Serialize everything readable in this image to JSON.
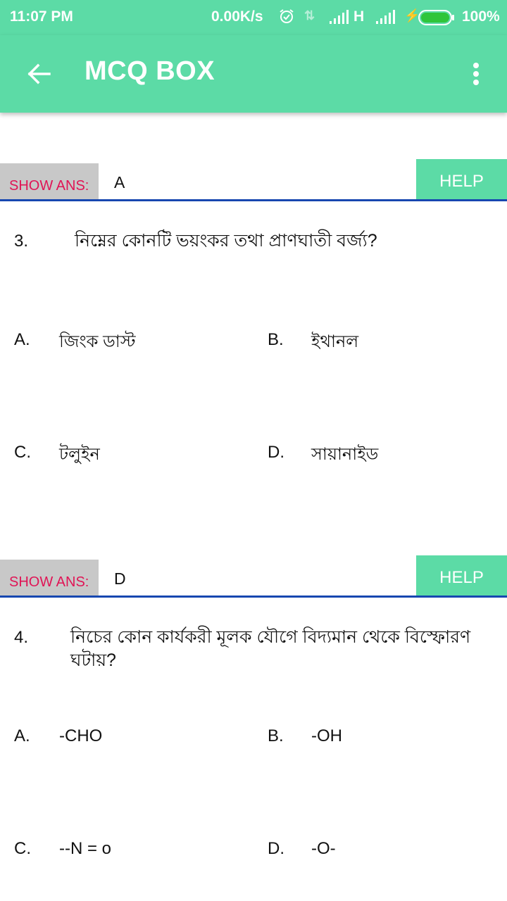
{
  "status_bar": {
    "time": "11:07 PM",
    "net_speed": "0.00K/s",
    "network_type": "H",
    "battery_percent": "100%",
    "icons": [
      "alarm-icon",
      "data-arrows-icon",
      "signal-icon",
      "signal-icon",
      "charging-icon",
      "battery-icon"
    ]
  },
  "app_bar": {
    "title": "MCQ BOX",
    "back_icon": "arrow-left-icon",
    "menu_icon": "more-vert-icon"
  },
  "questions": [
    {
      "show_ans_label": "SHOW ANS:",
      "answer": "A",
      "help_label": "HELP",
      "number": "3.",
      "text": "নিম্নের কোনটি ভয়ংকর তথা প্রাণঘাতী বর্জ্য?",
      "options": [
        {
          "label": "A.",
          "text": "জিংক ডাস্ট"
        },
        {
          "label": "B.",
          "text": "ইথানল"
        },
        {
          "label": "C.",
          "text": "টলুইন"
        },
        {
          "label": "D.",
          "text": "সায়ানাইড"
        }
      ]
    },
    {
      "show_ans_label": "SHOW ANS:",
      "answer": "D",
      "help_label": "HELP",
      "number": "4.",
      "text": "নিচের কোন কার্যকরী মূলক যৌগে বিদ্যমান থেকে বিস্ফোরণ ঘটায়?",
      "options": [
        {
          "label": "A.",
          "text": "-CHO"
        },
        {
          "label": "B.",
          "text": "-OH"
        },
        {
          "label": "C.",
          "text": "--N = o"
        },
        {
          "label": "D.",
          "text": "-O-"
        }
      ]
    }
  ],
  "colors": {
    "accent": "#5cdba6",
    "show_ans_text": "#e01455",
    "show_ans_bg": "#c8c8c8",
    "divider": "#1747b0"
  }
}
